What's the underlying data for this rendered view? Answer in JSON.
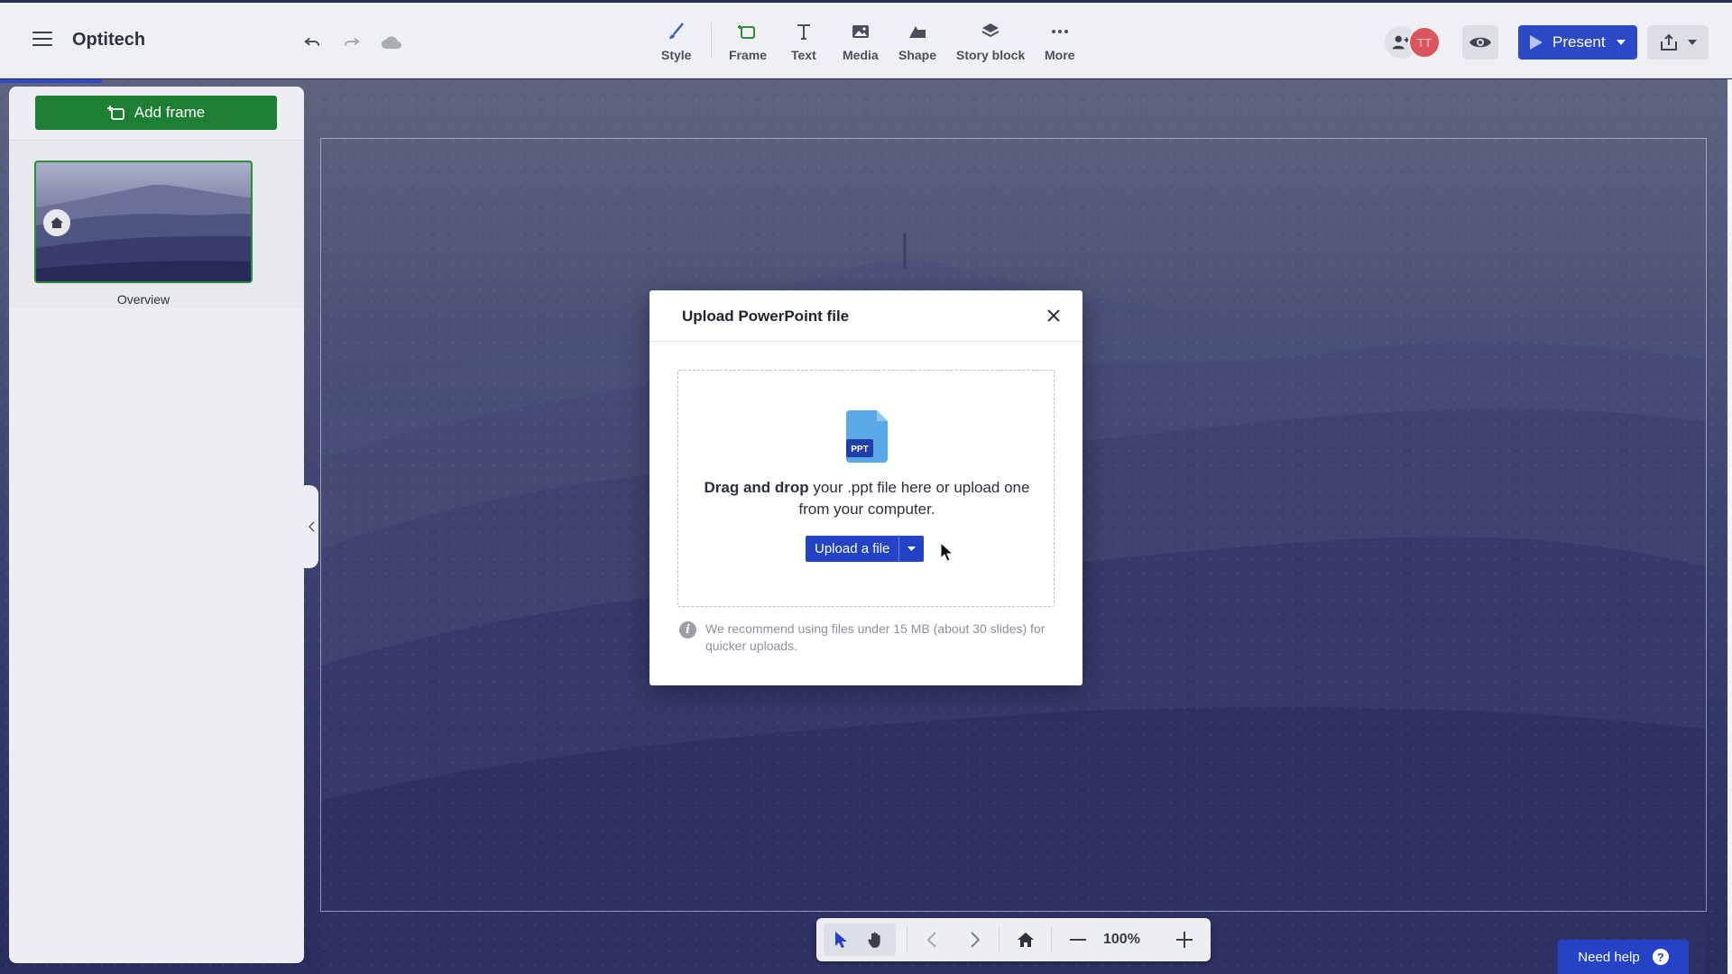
{
  "app": {
    "title": "Optitech"
  },
  "toolbar": {
    "tools": [
      {
        "label": "Style",
        "icon": "brush-icon"
      },
      {
        "label": "Frame",
        "icon": "frame-icon"
      },
      {
        "label": "Text",
        "icon": "text-icon"
      },
      {
        "label": "Media",
        "icon": "image-icon"
      },
      {
        "label": "Shape",
        "icon": "shape-icon"
      },
      {
        "label": "Story block",
        "icon": "layers-icon"
      },
      {
        "label": "More",
        "icon": "more-icon"
      }
    ],
    "avatar_initials": "TT",
    "present_label": "Present"
  },
  "sidebar": {
    "add_frame_label": "Add frame",
    "frames": [
      {
        "label": "Overview"
      }
    ]
  },
  "modal": {
    "title": "Upload PowerPoint file",
    "file_badge": "PPT",
    "drop_bold": "Drag and drop",
    "drop_rest": " your .ppt file here or upload one from your computer.",
    "upload_label": "Upload a file",
    "info_text": "We recommend using files under 15 MB (about 30 slides) for quicker uploads."
  },
  "bottombar": {
    "zoom": "100%"
  },
  "help": {
    "label": "Need help"
  },
  "colors": {
    "accent": "#2e49c8",
    "add_frame": "#1e7e34",
    "toolbar_bg": "#eff0f3"
  }
}
